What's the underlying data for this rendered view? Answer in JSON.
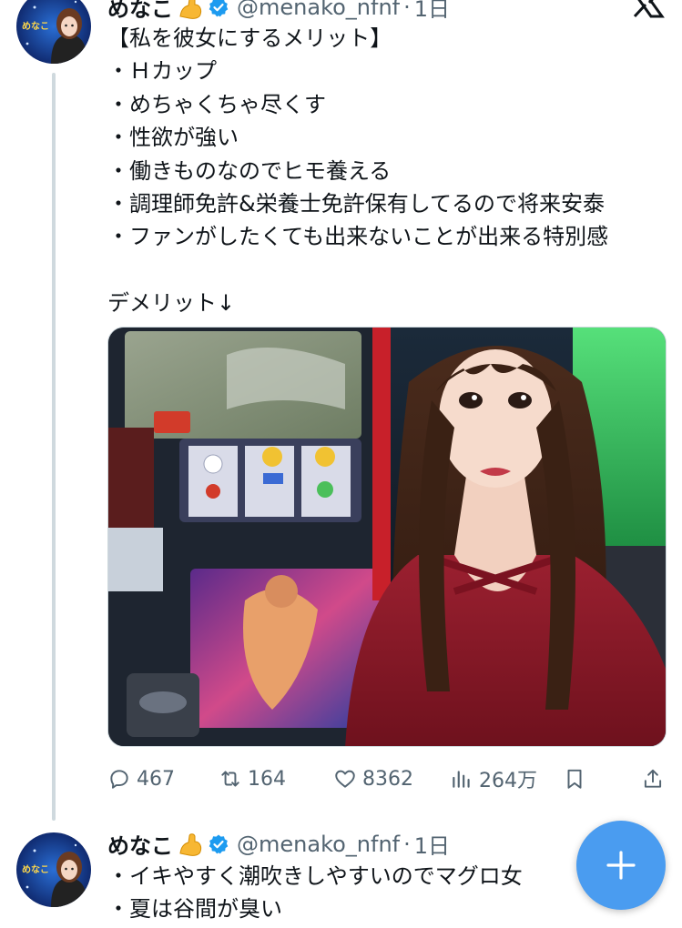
{
  "post1": {
    "author_name": "めなこ",
    "handle": "@menako_nfnf",
    "separator": "·",
    "time": "1日",
    "lines": [
      "【私を彼女にするメリット】",
      "・Ｈカップ",
      "・めちゃくちゃ尽くす",
      "・性欲が強い",
      "・働きものなのでヒモ養える",
      "・調理師免許&栄養士免許保有してるので将来安泰",
      "・ファンがしたくても出来ないことが出来る特別感",
      "",
      "デメリット↓"
    ],
    "stats": {
      "replies": "467",
      "reposts": "164",
      "likes": "8362",
      "views": "264万"
    }
  },
  "post2": {
    "author_name": "めなこ",
    "handle": "@menako_nfnf",
    "separator": "·",
    "time": "1日",
    "lines": [
      "・イキやすく潮吹きしやすいのでマグロ女",
      "・夏は谷間が臭い"
    ]
  },
  "avatar_text": "めなこ",
  "icons": {
    "reply": "reply-icon",
    "repost": "repost-icon",
    "like": "heart-icon",
    "views": "views-chart-icon",
    "bookmark": "bookmark-icon",
    "share": "share-icon",
    "verified": "verified-badge-icon",
    "emoji": "flexed-biceps-emoji",
    "close": "x-logo-icon",
    "compose": "plus-icon"
  },
  "colors": {
    "text": "#0f1419",
    "muted": "#536471",
    "verified": "#1d9bf0",
    "fab": "#4a9cf0",
    "thread_line": "#cfd9de"
  }
}
